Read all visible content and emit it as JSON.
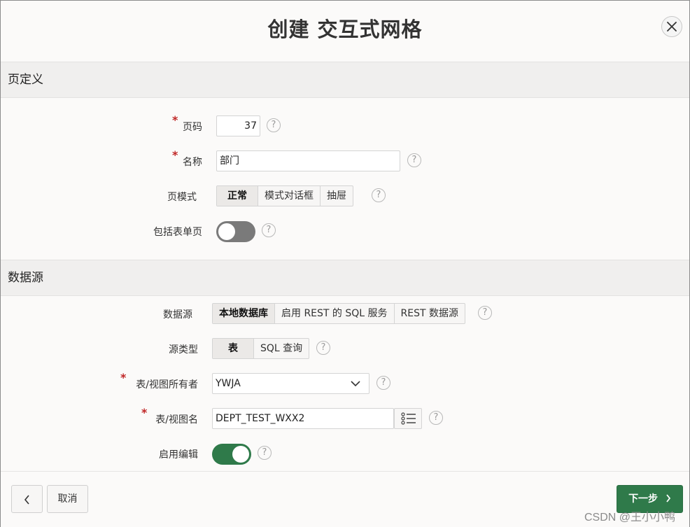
{
  "dialog": {
    "title": "创建 交互式网格",
    "close_icon": "close-icon"
  },
  "sections": {
    "page_definition": "页定义",
    "data_source": "数据源"
  },
  "page_definition": {
    "page_number": {
      "label": "页码",
      "value": "37",
      "required": "*"
    },
    "name": {
      "label": "名称",
      "value": "部门",
      "required": "*"
    },
    "page_mode": {
      "label": "页模式",
      "options": [
        "正常",
        "模式对话框",
        "抽屉"
      ],
      "selected": "正常"
    },
    "include_form_page": {
      "label": "包括表单页",
      "state": "off"
    }
  },
  "data_source": {
    "source": {
      "label": "数据源",
      "options": [
        "本地数据库",
        "启用 REST 的 SQL 服务",
        "REST 数据源"
      ],
      "selected": "本地数据库"
    },
    "source_type": {
      "label": "源类型",
      "options": [
        "表",
        "SQL 查询"
      ],
      "selected": "表"
    },
    "owner": {
      "label": "表/视图所有者",
      "value": "YWJA",
      "required": "*"
    },
    "table_name": {
      "label": "表/视图名",
      "value": "DEPT_TEST_WXX2",
      "required": "*"
    },
    "enable_edit": {
      "label": "启用编辑",
      "state": "on"
    }
  },
  "help_glyph": "?",
  "footer": {
    "back_icon": "chevron-left-icon",
    "cancel_label": "取消",
    "next_label": "下一步"
  },
  "colors": {
    "primary": "#2f7a4a",
    "toggle_off": "#7a7a7a",
    "required": "#c02626"
  },
  "watermark": "CSDN @王小小鸭"
}
